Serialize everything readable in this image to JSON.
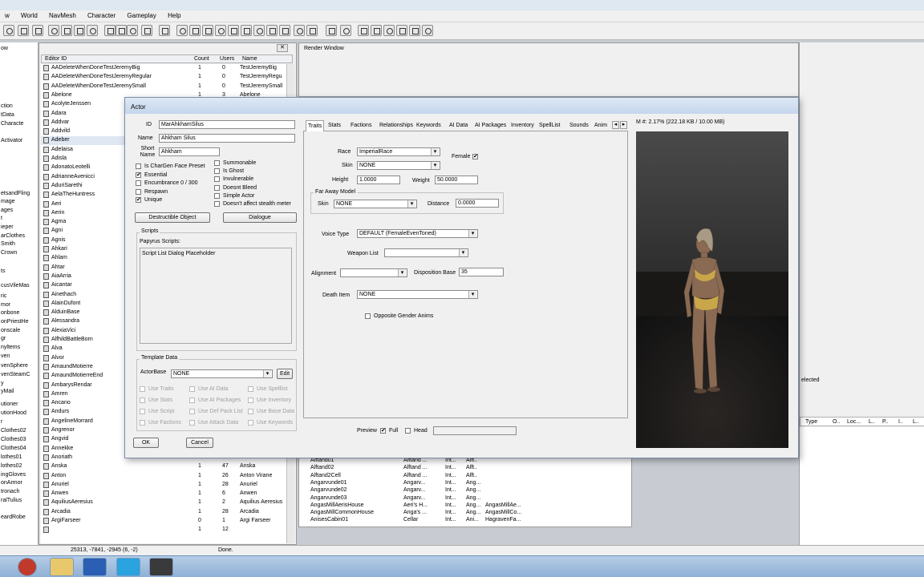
{
  "menubar": {
    "items": [
      "w",
      "World",
      "NavMesh",
      "Character",
      "Gameplay",
      "Help"
    ]
  },
  "leftpane": {
    "title": "ow",
    "items": [
      "ction",
      "tData",
      "Characte",
      "Activator",
      "etsandFling",
      "mage",
      "ages",
      "t",
      "ieper",
      "arClothes",
      "Smith",
      "Crown",
      "ts",
      "cusVileMas",
      "ric",
      "mor",
      "onbone",
      "onPriestHe",
      "onscale",
      "gr",
      "nyltems",
      "ven",
      "venSphere",
      "venSteamC",
      "y",
      "yMail",
      "utioner",
      "utionHood",
      "r",
      "Clothes02",
      "Clothes03",
      "Clothes04",
      "lothes01",
      "lothes02",
      "ingGloves",
      "onArmor",
      "tronach",
      "ralTulius",
      "eardRobe"
    ]
  },
  "objectwindow": {
    "close": "✕",
    "columns": [
      "Editor ID",
      "Count",
      "Users",
      "Name"
    ],
    "rows": [
      {
        "id": "AADeleteWhenDoneTestJeremyBig",
        "count": "1",
        "users": "0",
        "name": "TestJeremyBig"
      },
      {
        "id": "AADeleteWhenDoneTestJeremyRegular",
        "count": "1",
        "users": "0",
        "name": "TestJeremyRegu"
      },
      {
        "id": "AADeleteWhenDoneTestJeremySmall",
        "count": "1",
        "users": "0",
        "name": "TestJeremySmall"
      },
      {
        "id": "Abelone",
        "count": "1",
        "users": "3",
        "name": "Abelone"
      },
      {
        "id": "AcolyteJenssen",
        "count": "",
        "users": "",
        "name": ""
      },
      {
        "id": "Adara",
        "count": "",
        "users": "",
        "name": ""
      },
      {
        "id": "Addvar",
        "count": "",
        "users": "",
        "name": ""
      },
      {
        "id": "Addvild",
        "count": "",
        "users": "",
        "name": ""
      },
      {
        "id": "Adeber",
        "count": "",
        "users": "",
        "name": ""
      },
      {
        "id": "Adelaisa",
        "count": "",
        "users": "",
        "name": ""
      },
      {
        "id": "Adisla",
        "count": "",
        "users": "",
        "name": ""
      },
      {
        "id": "AdonatoLeotelli",
        "count": "",
        "users": "",
        "name": ""
      },
      {
        "id": "AdrianneAvenicci",
        "count": "",
        "users": "",
        "name": ""
      },
      {
        "id": "AduriSarethi",
        "count": "",
        "users": "",
        "name": ""
      },
      {
        "id": "AelaTheHuntress",
        "count": "",
        "users": "",
        "name": ""
      },
      {
        "id": "Aeri",
        "count": "",
        "users": "",
        "name": ""
      },
      {
        "id": "Aerin",
        "count": "",
        "users": "",
        "name": ""
      },
      {
        "id": "Agma",
        "count": "",
        "users": "",
        "name": ""
      },
      {
        "id": "Agni",
        "count": "",
        "users": "",
        "name": ""
      },
      {
        "id": "Agnis",
        "count": "",
        "users": "",
        "name": ""
      },
      {
        "id": "Ahkari",
        "count": "",
        "users": "",
        "name": ""
      },
      {
        "id": "Ahlam",
        "count": "",
        "users": "",
        "name": ""
      },
      {
        "id": "Ahtar",
        "count": "",
        "users": "",
        "name": ""
      },
      {
        "id": "AiaArria",
        "count": "",
        "users": "",
        "name": ""
      },
      {
        "id": "Aicantar",
        "count": "",
        "users": "",
        "name": ""
      },
      {
        "id": "Ainethach",
        "count": "",
        "users": "",
        "name": ""
      },
      {
        "id": "AlainDufont",
        "count": "",
        "users": "",
        "name": ""
      },
      {
        "id": "AlduinBase",
        "count": "",
        "users": "",
        "name": ""
      },
      {
        "id": "Alessandra",
        "count": "",
        "users": "",
        "name": ""
      },
      {
        "id": "AlexiaVici",
        "count": "",
        "users": "",
        "name": ""
      },
      {
        "id": "AlfhildBattleBorn",
        "count": "",
        "users": "",
        "name": ""
      },
      {
        "id": "Alva",
        "count": "",
        "users": "",
        "name": ""
      },
      {
        "id": "Alvor",
        "count": "",
        "users": "",
        "name": ""
      },
      {
        "id": "AmaundMotierre",
        "count": "",
        "users": "",
        "name": ""
      },
      {
        "id": "AmaundMotierreEnd",
        "count": "",
        "users": "",
        "name": ""
      },
      {
        "id": "AmbarysRendar",
        "count": "",
        "users": "",
        "name": ""
      },
      {
        "id": "Amren",
        "count": "",
        "users": "",
        "name": ""
      },
      {
        "id": "Ancano",
        "count": "",
        "users": "",
        "name": ""
      },
      {
        "id": "Andurs",
        "count": "",
        "users": "",
        "name": ""
      },
      {
        "id": "AngelineMorrard",
        "count": "",
        "users": "",
        "name": ""
      },
      {
        "id": "Angrenor",
        "count": "",
        "users": "",
        "name": ""
      },
      {
        "id": "Angvid",
        "count": "",
        "users": "",
        "name": ""
      },
      {
        "id": "Annekke",
        "count": "",
        "users": "",
        "name": ""
      },
      {
        "id": "Anoriath",
        "count": "1",
        "users": "33",
        "name": "Anoriath"
      },
      {
        "id": "Anska",
        "count": "1",
        "users": "47",
        "name": "Anska"
      },
      {
        "id": "Anton",
        "count": "1",
        "users": "26",
        "name": "Anton Virane"
      },
      {
        "id": "Anuriel",
        "count": "1",
        "users": "28",
        "name": "Anuriel"
      },
      {
        "id": "Anwen",
        "count": "1",
        "users": "6",
        "name": "Anwen"
      },
      {
        "id": "AquiliusAeresius",
        "count": "1",
        "users": "2",
        "name": "Aquilius Aeresius"
      },
      {
        "id": "Arcadia",
        "count": "1",
        "users": "28",
        "name": "Arcadia"
      },
      {
        "id": "ArgiFarseer",
        "count": "0",
        "users": "1",
        "name": "Argi Farseer"
      },
      {
        "id": "",
        "count": "1",
        "users": "12",
        "name": ""
      }
    ]
  },
  "renderwindow": {
    "title": "Render Window"
  },
  "cellpane": {
    "selected_text": "elected",
    "columns": [
      "Type",
      "O..",
      "Loc...",
      "L..",
      "P..",
      "I..",
      "L.."
    ]
  },
  "bottompane": {
    "rows": [
      [
        "Alftand01",
        "Alftand ...",
        "Int...",
        "Alft..",
        ""
      ],
      [
        "Alftand02",
        "Alftand ...",
        "Int...",
        "Alft..",
        ""
      ],
      [
        "Alftand2Cell",
        "Alftand ...",
        "Int...",
        "Alft..",
        ""
      ],
      [
        "Angarvunde01",
        "Angarv...",
        "Int...",
        "Ang...",
        ""
      ],
      [
        "Angarvunde02",
        "Angarv...",
        "Int...",
        "Ang...",
        ""
      ],
      [
        "Angarvunde03",
        "Angarv...",
        "Int...",
        "Ang...",
        ""
      ],
      [
        "AngasMillAerisHouse",
        "Aeri's H...",
        "Int...",
        "Ang...",
        "AngasMillAe..."
      ],
      [
        "AngasMillCommonHouse",
        "Anga's ...",
        "Int...",
        "Ang...",
        "AngasMillCo..."
      ],
      [
        "AnisesCabin01",
        "Cellar",
        "Int...",
        "Ani...",
        "HagravenFa..."
      ]
    ]
  },
  "statusbar": {
    "coords": "25313, -7841, -2945 (6, -2)",
    "status": "Done."
  },
  "dialog": {
    "title": "Actor",
    "id_label": "ID",
    "id_value": "MarAhkhamSilus",
    "name_label": "Name",
    "name_value": "Ahkham Silus",
    "short_name_label": "Short Name",
    "short_name_value": "Ahkham",
    "flags_left": [
      {
        "label": "Is CharGen Face Preset",
        "checked": false
      },
      {
        "label": "Essential",
        "checked": true
      },
      {
        "label": "Encumbrance 0 / 300",
        "checked": false
      },
      {
        "label": "Respawn",
        "checked": false
      },
      {
        "label": "Unique",
        "checked": true
      }
    ],
    "flags_right": [
      {
        "label": "Summonable",
        "checked": false
      },
      {
        "label": "Is Ghost",
        "checked": false
      },
      {
        "label": "Invulnerable",
        "checked": false
      },
      {
        "label": "Doesnt Bleed",
        "checked": false
      },
      {
        "label": "Simple Actor",
        "checked": false
      },
      {
        "label": "Doesn't affect stealth meter",
        "checked": false
      }
    ],
    "destructible_button": "Destructible Object",
    "dialogue_button": "Dialogue",
    "scripts_group": "Scripts",
    "papyrus_label": "Papyrus Scripts:",
    "script_placeholder": "Script List Dialog Placeholder",
    "template_group": "Template Data",
    "actorbase_label": "ActorBase",
    "actorbase_value": "NONE",
    "edit_button": "Edit",
    "template_flags": [
      "Use Traits",
      "Use AI Data",
      "Use Spelllist",
      "Use Stats",
      "Use AI Packages",
      "Use Inventory",
      "Use Script",
      "Use Def Pack List",
      "Use Base Data",
      "Use Factions",
      "Use Attack Data",
      "Use Keywords"
    ],
    "ok_button": "OK",
    "cancel_button": "Cancel",
    "tabs": [
      "Traits",
      "Stats",
      "Factions",
      "Relationships",
      "Keywords",
      "AI Data",
      "AI Packages",
      "Inventory",
      "SpellList",
      "Sounds",
      "Anim"
    ],
    "tab_scroll_left": "◂",
    "tab_scroll_right": "▸",
    "race_label": "Race",
    "race_value": "ImperialRace",
    "female_label": "Female",
    "female_checked": true,
    "skin_label": "Skin",
    "skin_value": "NONE",
    "height_label": "Height",
    "height_value": "1.0000",
    "weight_label": "Weight",
    "weight_value": "50.0000",
    "faraway_group": "Far Away Model",
    "far_skin_label": "Skin",
    "far_skin_value": "NONE",
    "distance_label": "Distance",
    "distance_value": "0.0000",
    "voice_label": "Voice Type",
    "voice_value": "DEFAULT (FemaleEvenToned)",
    "weapon_label": "Weapon List",
    "weapon_value": "",
    "alignment_label": "Alignment",
    "alignment_value": "",
    "disposition_label": "Disposition Base",
    "disposition_value": "35",
    "death_label": "Death Item",
    "death_value": "NONE",
    "opposite_gender_label": "Opposite Gender Anims",
    "preview_label": "Preview",
    "full_label": "Full",
    "head_label": "Head",
    "memory_text": "M #: 2.17% (222.18 KB / 10.00 MB)"
  },
  "colors": {
    "accent": "#c5d6ec",
    "preview_bg": "#3a3a3a"
  }
}
